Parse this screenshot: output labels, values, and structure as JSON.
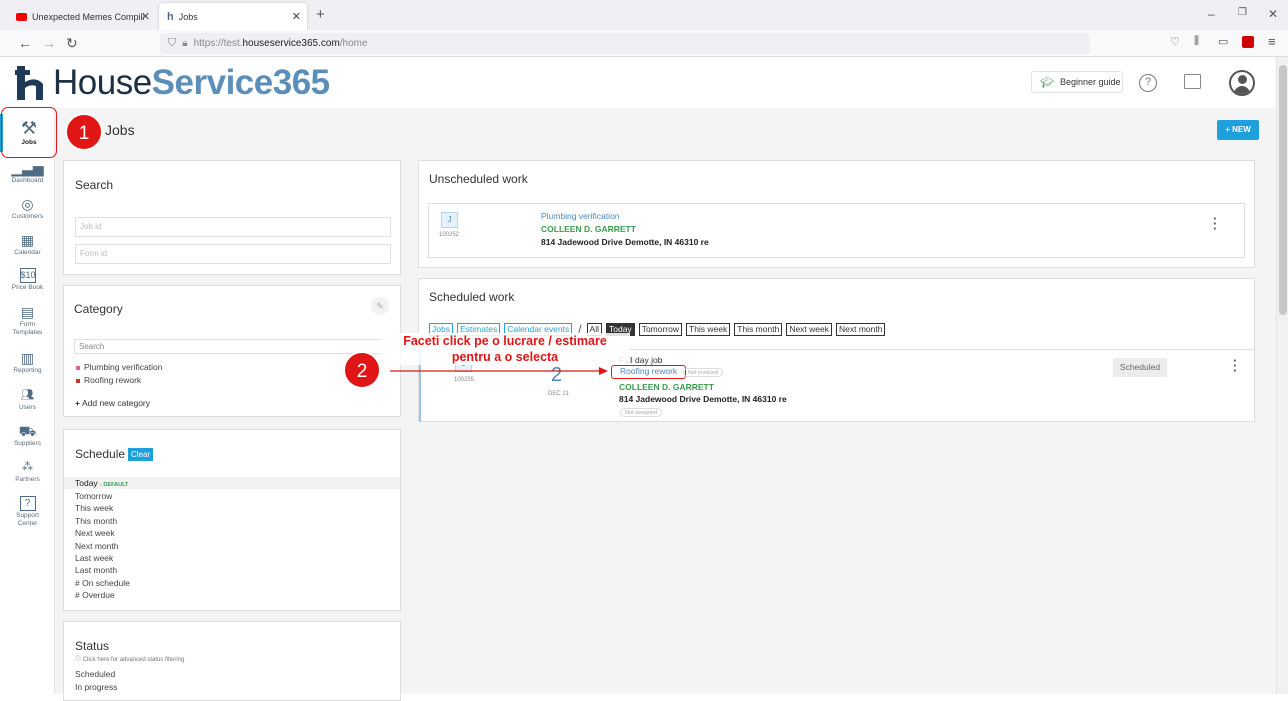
{
  "browser": {
    "tabs": [
      {
        "title": "Unexpected Memes Compilatio"
      },
      {
        "title": "Jobs"
      }
    ],
    "url_prefix": "https://test.",
    "url_domain": "houseservice365.com",
    "url_path": "/home"
  },
  "header": {
    "logo_house": "House",
    "logo_service": "Service365",
    "beginner_guide": "Beginner guide"
  },
  "sidebar": {
    "items": [
      {
        "label": "Jobs",
        "icon": "tools-icon"
      },
      {
        "label": "Dashboard",
        "icon": "chart-icon"
      },
      {
        "label": "Customers",
        "icon": "customers-icon"
      },
      {
        "label": "Calendar",
        "icon": "calendar-icon"
      },
      {
        "label": "Price Book",
        "icon": "pricebook-icon"
      },
      {
        "label": "Form",
        "label2": "Templates",
        "icon": "form-icon"
      },
      {
        "label": "Reporting",
        "icon": "reporting-icon"
      },
      {
        "label": "Users",
        "icon": "users-icon"
      },
      {
        "label": "Suppliers",
        "icon": "truck-icon"
      },
      {
        "label": "Partners",
        "icon": "partners-icon"
      },
      {
        "label": "Support",
        "label2": "Center",
        "icon": "support-icon"
      }
    ]
  },
  "page": {
    "title": "Jobs",
    "new_button": "+ NEW"
  },
  "search": {
    "title": "Search",
    "job_id_placeholder": "Job id",
    "form_id_placeholder": "Form id"
  },
  "category": {
    "title": "Category",
    "search_placeholder": "Search",
    "items": [
      {
        "label": "Plumbing verification",
        "color": "#e05fa6"
      },
      {
        "label": "Roofing rework",
        "color": "#c0392b"
      }
    ],
    "add_new": "Add new category"
  },
  "schedule": {
    "title": "Schedule",
    "clear": "Clear",
    "today": "Today",
    "default_tag": "- DEFAULT",
    "items": [
      "Tomorrow",
      "This week",
      "This month",
      "Next week",
      "Next month",
      "Last week",
      "Last month",
      "# On schedule",
      "# Overdue"
    ]
  },
  "status": {
    "title": "Status",
    "hint": "Click here for advanced status filtering",
    "items": [
      "Scheduled",
      "In progress"
    ]
  },
  "unscheduled": {
    "title": "Unscheduled work",
    "job": {
      "badge": "J",
      "id": "100252",
      "category": "Plumbing verification",
      "customer": "COLLEEN D. GARRETT",
      "address": "814 Jadewood Drive Demotte, IN 46310 re"
    }
  },
  "scheduled": {
    "title": "Scheduled work",
    "type_filters": [
      "Jobs",
      "Estimates",
      "Calendar events"
    ],
    "separator": "/",
    "range_filters": [
      "All",
      "Today",
      "Tomorrow",
      "This week",
      "This month",
      "Next week",
      "Next month"
    ],
    "active_range": "Today",
    "job": {
      "badge": "J",
      "id": "100255",
      "day": "2",
      "date": "DEC 21",
      "type": "Full day job",
      "category": "Roofing rework",
      "invoice": "Not invoiced",
      "customer": "COLLEEN D. GARRETT",
      "address": "814 Jadewood Drive Demotte, IN 46310 re",
      "assigned": "Not assigned",
      "status": "Scheduled"
    }
  },
  "annotations": {
    "step1": "1",
    "step2": "2",
    "instruction_line1": "Faceti click pe o lucrare / estimare",
    "instruction_line2": "pentru a o selecta",
    "color": "#e01515"
  }
}
